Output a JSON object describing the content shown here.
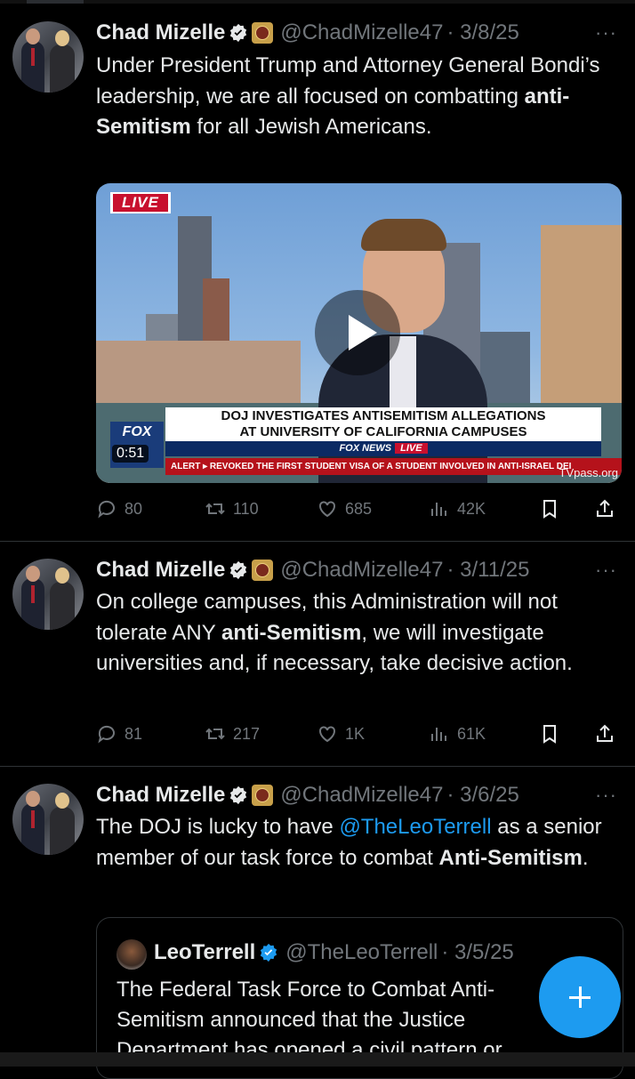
{
  "tweets": [
    {
      "name": "Chad Mizelle",
      "handle": "@ChadMizelle47",
      "date": "· 3/8/25",
      "more": "···",
      "text_parts": [
        "Under President Trump and Attorney General Bondi’s leadership, we are all focused on combatting ",
        "anti-Semitism",
        " for all Jewish Americans."
      ],
      "media": {
        "live_badge": "LIVE",
        "headline_1": "DOJ INVESTIGATES ANTISEMITISM ALLEGATIONS",
        "headline_2": "AT UNIVERSITY OF CALIFORNIA CAMPUSES",
        "network": "FOX NEWS",
        "network_live": "LIVE",
        "alert": "ALERT ▸ REVOKED THE FIRST STUDENT VISA OF A STUDENT INVOLVED IN ANTI-ISRAEL DEI",
        "logo": "FOX",
        "duration": "0:51",
        "watermark": "TVpass.org"
      },
      "stats": {
        "replies": "80",
        "reposts": "110",
        "likes": "685",
        "views": "42K"
      }
    },
    {
      "name": "Chad Mizelle",
      "handle": "@ChadMizelle47",
      "date": "· 3/11/25",
      "more": "···",
      "text_parts": [
        "On college campuses, this Administration will not tolerate ANY ",
        "anti-Semitism",
        ", we will investigate universities and, if necessary, take decisive action."
      ],
      "stats": {
        "replies": "81",
        "reposts": "217",
        "likes": "1K",
        "views": "61K"
      }
    },
    {
      "name": "Chad Mizelle",
      "handle": "@ChadMizelle47",
      "date": "· 3/6/25",
      "more": "···",
      "text_parts": [
        "The DOJ is lucky to have ",
        "@TheLeoTerrell",
        " as a senior member of our task force to combat ",
        "Anti-Semitism",
        "."
      ],
      "quote": {
        "name": "LeoTerrell",
        "handle": "@TheLeoTerrell",
        "date": "· 3/5/25",
        "text": "The Federal Task Force to Combat Anti-Semitism announced that the Justice Department has opened a civil pattern or"
      }
    }
  ],
  "colors": {
    "accent": "#1d9bf0",
    "muted": "#71767b",
    "text": "#e7e9ea",
    "background": "#000000"
  },
  "icons": [
    "verified-icon",
    "reply-icon",
    "repost-icon",
    "like-icon",
    "views-icon",
    "bookmark-icon",
    "share-icon",
    "compose-icon"
  ]
}
